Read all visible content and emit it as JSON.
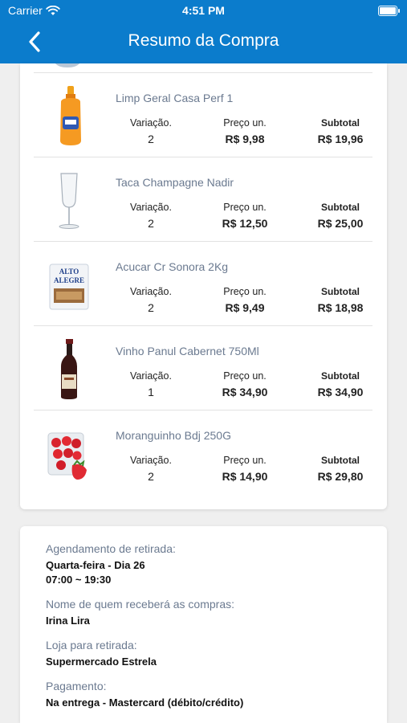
{
  "status_bar": {
    "carrier": "Carrier",
    "time": "4:51 PM"
  },
  "header": {
    "title": "Resumo da Compra"
  },
  "columns": {
    "variation": "Variação.",
    "unit_price": "Preço un.",
    "subtotal": "Subtotal"
  },
  "items": [
    {
      "name": "Limp Geral Casa Perf 1",
      "variation": "2",
      "unit_price": "R$ 9,98",
      "subtotal": "R$ 19,96",
      "icon": "cleaner-bottle-icon"
    },
    {
      "name": "Taca Champagne Nadir",
      "variation": "2",
      "unit_price": "R$ 12,50",
      "subtotal": "R$ 25,00",
      "icon": "champagne-glass-icon"
    },
    {
      "name": "Acucar Cr Sonora 2Kg",
      "variation": "2",
      "unit_price": "R$ 9,49",
      "subtotal": "R$ 18,98",
      "icon": "sugar-bag-icon",
      "brand_text": "ALTO ALEGRE"
    },
    {
      "name": "Vinho Panul Cabernet  750Ml",
      "variation": "1",
      "unit_price": "R$ 34,90",
      "subtotal": "R$ 34,90",
      "icon": "wine-bottle-icon"
    },
    {
      "name": "Moranguinho Bdj 250G",
      "variation": "2",
      "unit_price": "R$ 14,90",
      "subtotal": "R$ 29,80",
      "icon": "strawberry-box-icon"
    }
  ],
  "summary": {
    "pickup_label": "Agendamento de retirada:",
    "pickup_day": "Quarta-feira - Dia 26",
    "pickup_time": "07:00 ~ 19:30",
    "receiver_label": "Nome de quem receberá as compras:",
    "receiver_name": "Irina Lira",
    "store_label": "Loja para retirada:",
    "store_name": "Supermercado Estrela",
    "payment_label": "Pagamento:",
    "payment_value": "Na entrega - Mastercard (débito/crédito)"
  },
  "colors": {
    "header_bg": "#0b7ccc",
    "label_gray": "#6b7a90",
    "background": "#efefef"
  }
}
